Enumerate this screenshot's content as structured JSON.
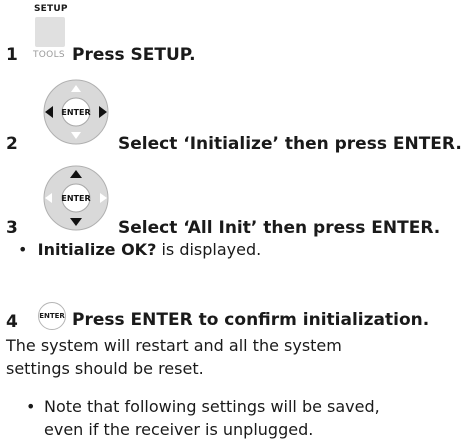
{
  "steps": [
    {
      "number": "1",
      "button_top_label": "SETUP",
      "button_bottom_label": "TOOLS",
      "text": "Press SETUP.",
      "button_icon": "setup-tools-button"
    },
    {
      "number": "2",
      "button_label": "ENTER",
      "text": "Select ‘Initialize’ then press ENTER.",
      "button_icon": "dpad-left-right"
    },
    {
      "number": "3",
      "button_label": "ENTER",
      "text": "Select ‘All Init’ then press ENTER.",
      "button_icon": "dpad-up-down"
    },
    {
      "number": "4",
      "button_label": "ENTER",
      "text": "Press ENTER to confirm initialization.",
      "button_icon": "enter-button"
    }
  ],
  "step3_note": {
    "bold": "Initialize OK?",
    "rest": " is displayed."
  },
  "restart_text": {
    "line1": "The system will restart and all the system",
    "line2": "settings should be reset."
  },
  "note": {
    "line1": "Note that following settings will be saved,",
    "line2": "even if the receiver is unplugged."
  },
  "bullet_char": "•"
}
